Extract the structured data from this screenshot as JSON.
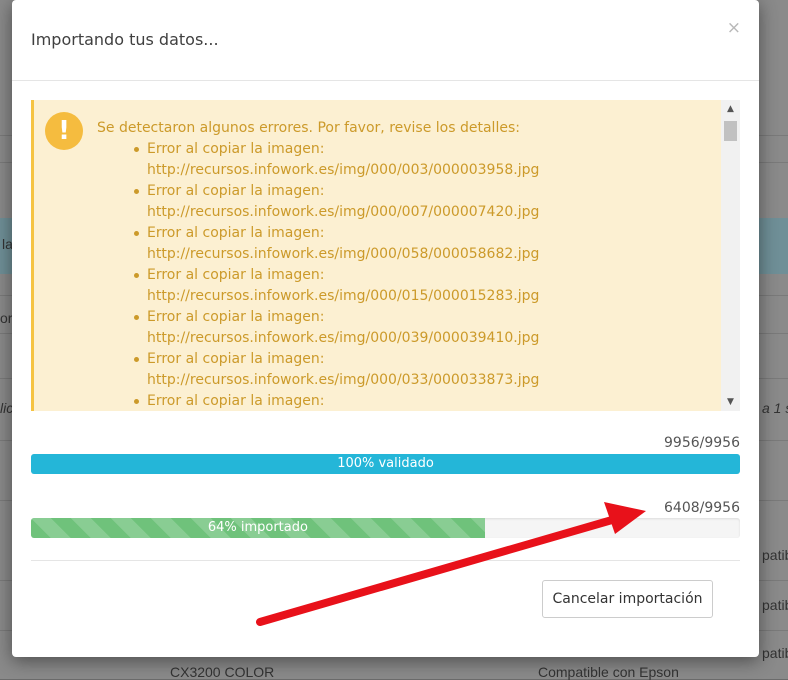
{
  "background": {
    "fragments": [
      "la",
      "or",
      "lic",
      "a 1 s",
      "patib",
      "patib",
      "patib",
      "CX3200 COLOR",
      "Compatible con Epson"
    ]
  },
  "modal": {
    "title": "Importando tus datos...",
    "close_label": "×"
  },
  "alert": {
    "icon": "exclamation-icon",
    "heading": "Se detectaron algunos errores. Por favor, revise los detalles:",
    "items": [
      {
        "label": "Error al copiar la imagen:",
        "url": "http://recursos.infowork.es/img/000/003/000003958.jpg"
      },
      {
        "label": "Error al copiar la imagen:",
        "url": "http://recursos.infowork.es/img/000/007/000007420.jpg"
      },
      {
        "label": "Error al copiar la imagen:",
        "url": "http://recursos.infowork.es/img/000/058/000058682.jpg"
      },
      {
        "label": "Error al copiar la imagen:",
        "url": "http://recursos.infowork.es/img/000/015/000015283.jpg"
      },
      {
        "label": "Error al copiar la imagen:",
        "url": "http://recursos.infowork.es/img/000/039/000039410.jpg"
      },
      {
        "label": "Error al copiar la imagen:",
        "url": "http://recursos.infowork.es/img/000/033/000033873.jpg"
      },
      {
        "label": "Error al copiar la imagen:",
        "url": ""
      }
    ],
    "scroll_up": "▲",
    "scroll_down": "▼"
  },
  "validation": {
    "count": "9956/9956",
    "label": "100% validado",
    "percent": 100,
    "color": "#24b6d8"
  },
  "import": {
    "count": "6408/9956",
    "label": "64% importado",
    "percent": 64,
    "color": "#6fc27b"
  },
  "actions": {
    "cancel_label": "Cancelar importación"
  },
  "annotation": {
    "arrow_color": "#e8111a"
  }
}
